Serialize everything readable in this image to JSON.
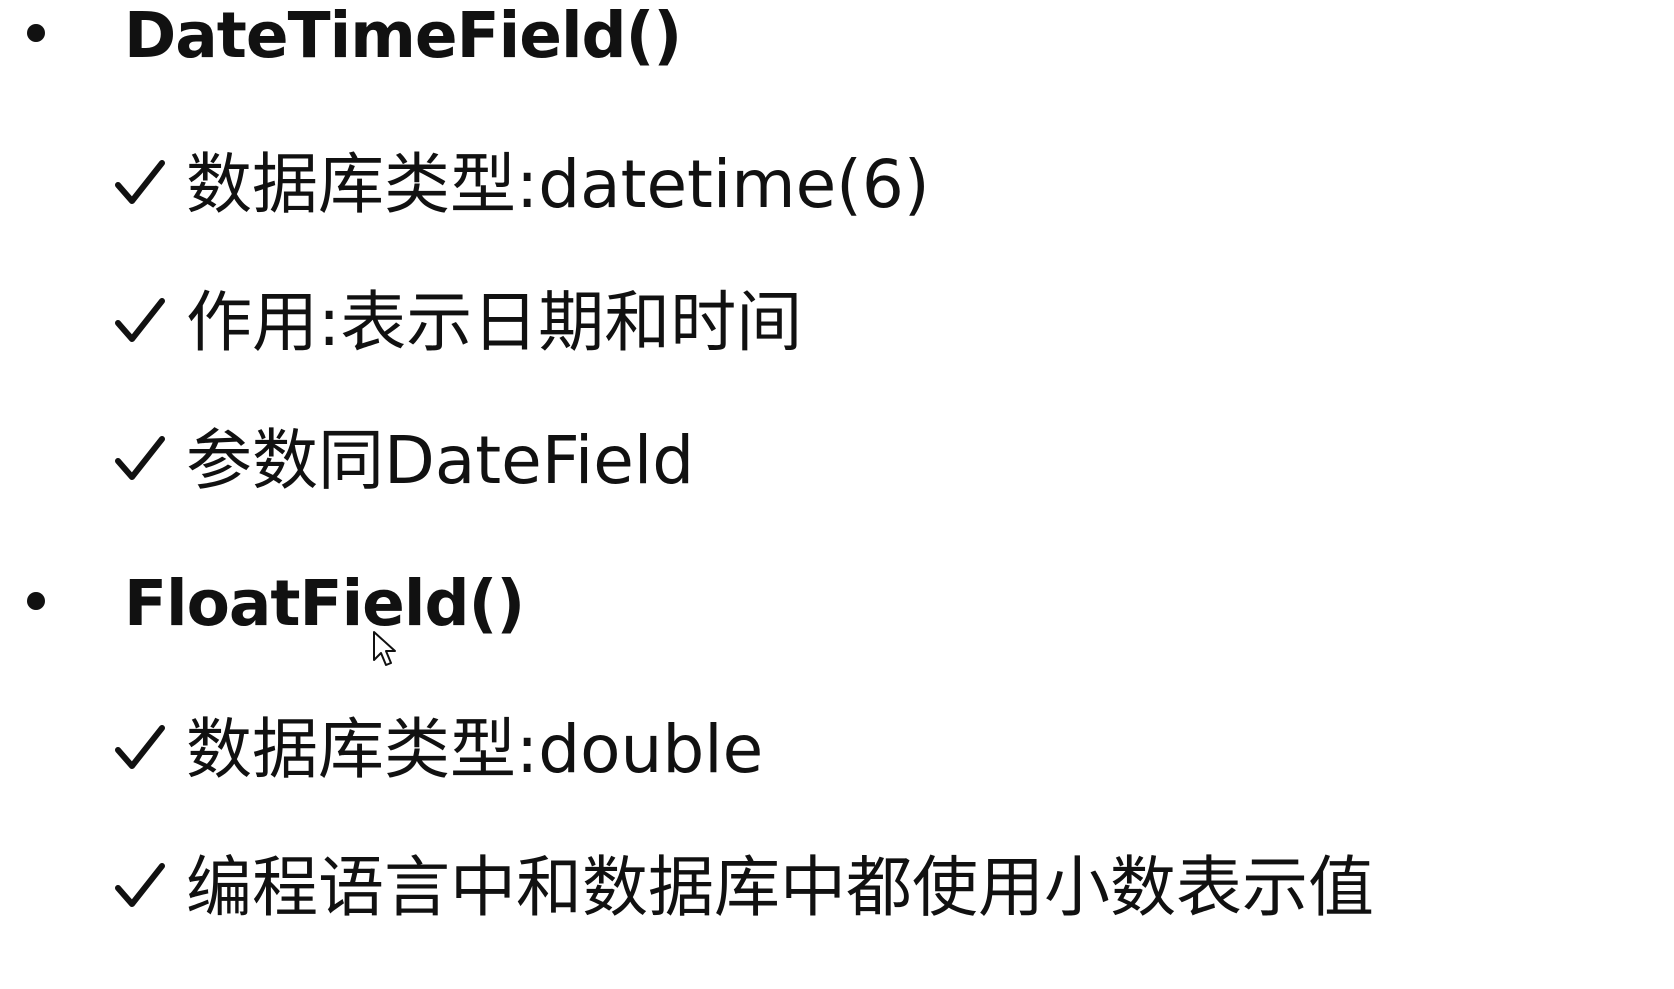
{
  "sections": [
    {
      "heading": "DateTimeField()",
      "items": [
        "数据库类型:datetime(6)",
        "作用:表示日期和时间",
        "参数同DateField"
      ]
    },
    {
      "heading": "FloatField()",
      "items": [
        "数据库类型:double",
        "编程语言中和数据库中都使用小数表示值"
      ]
    }
  ],
  "icons": {
    "bullet": "bullet-dot-icon",
    "check": "checkmark-icon",
    "cursor": "mouse-pointer-icon"
  },
  "colors": {
    "text": "#111111",
    "background": "#ffffff"
  }
}
